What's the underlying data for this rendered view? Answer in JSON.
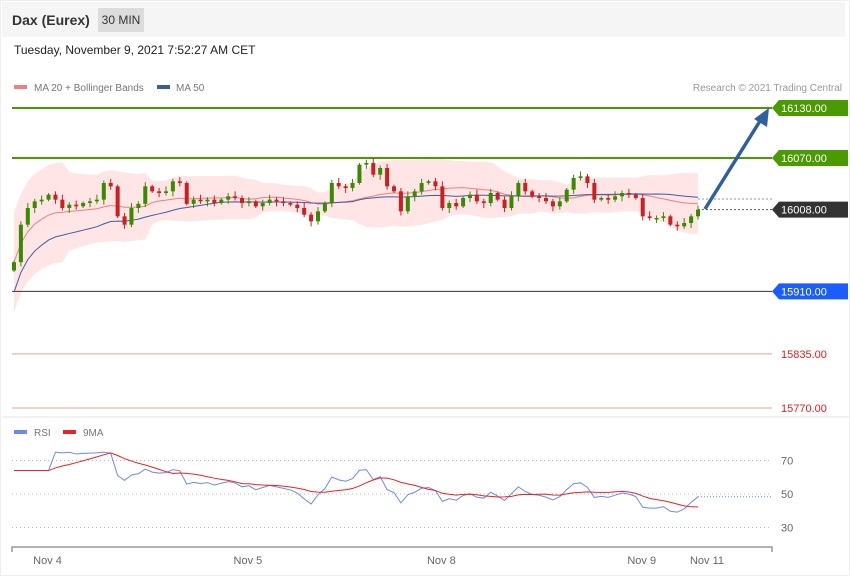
{
  "header": {
    "title": "Dax (Eurex)",
    "timeframe": "30 MIN",
    "timestamp": "Tuesday, November 9, 2021 7:52:27 AM CET"
  },
  "legend": {
    "ma20": "MA 20 + Bollinger Bands",
    "ma50": "MA 50",
    "credit": "Research © 2021 Trading Central",
    "rsi": "RSI",
    "rsi_ma": "9MA"
  },
  "colors": {
    "up": "#3a8a00",
    "down": "#cc1f1f",
    "ma20": "#f08080",
    "ma50": "#3a5fa0",
    "band": "#ffe2e2",
    "resistance": "#4a9a00",
    "pivot": "#1a5cff",
    "support": "#e02020",
    "arrow": "#2f5f9e",
    "rsi": "#6b8be8",
    "rsi_ma": "#ee2222"
  },
  "chart_data": {
    "type": "candlestick",
    "title": "Dax (Eurex) 30 MIN",
    "ylim": [
      15760,
      16150
    ],
    "levels": [
      {
        "value": 16130,
        "label": "16130.00",
        "kind": "resistance"
      },
      {
        "value": 16070,
        "label": "16070.00",
        "kind": "resistance"
      },
      {
        "value": 16008,
        "label": "16008.00",
        "kind": "last"
      },
      {
        "value": 15910,
        "label": "15910.00",
        "kind": "pivot"
      },
      {
        "value": 15835,
        "label": "15835.00",
        "kind": "support"
      },
      {
        "value": 15770,
        "label": "15770.00",
        "kind": "support"
      }
    ],
    "closes": [
      15945,
      15990,
      16010,
      16018,
      16020,
      16026,
      16020,
      16010,
      16014,
      16012,
      16016,
      16018,
      16020,
      16040,
      16036,
      16000,
      15990,
      16010,
      16015,
      16036,
      16030,
      16028,
      16030,
      16042,
      16040,
      16015,
      16020,
      16018,
      16020,
      16016,
      16020,
      16024,
      16022,
      16016,
      16018,
      16012,
      16016,
      16020,
      16018,
      16016,
      16014,
      16010,
      16002,
      15994,
      16006,
      16016,
      16040,
      16036,
      16034,
      16040,
      16062,
      16064,
      16050,
      16058,
      16036,
      16030,
      16006,
      16024,
      16030,
      16040,
      16042,
      16036,
      16010,
      16016,
      16012,
      16022,
      16026,
      16018,
      16016,
      16028,
      16020,
      16010,
      16024,
      16040,
      16030,
      16024,
      16022,
      16018,
      16012,
      16018,
      16032,
      16046,
      16048,
      16040,
      16020,
      16022,
      16020,
      16024,
      16028,
      16026,
      16022,
      16000,
      15998,
      15998,
      16000,
      15990,
      15988,
      15992,
      16000,
      16008
    ],
    "first_open": 15935,
    "target": 16130,
    "x_ticks": [
      {
        "label": "Nov 4",
        "index": 5
      },
      {
        "label": "Nov 5",
        "index": 34
      },
      {
        "label": "Nov 8",
        "index": 62
      },
      {
        "label": "Nov 9",
        "index": 91
      },
      {
        "label": "Nov 11",
        "index": 101
      }
    ],
    "rsi": {
      "ylim": [
        20,
        80
      ],
      "ticks": [
        70,
        50,
        30
      ],
      "period": 14,
      "ma_period": 9
    }
  }
}
